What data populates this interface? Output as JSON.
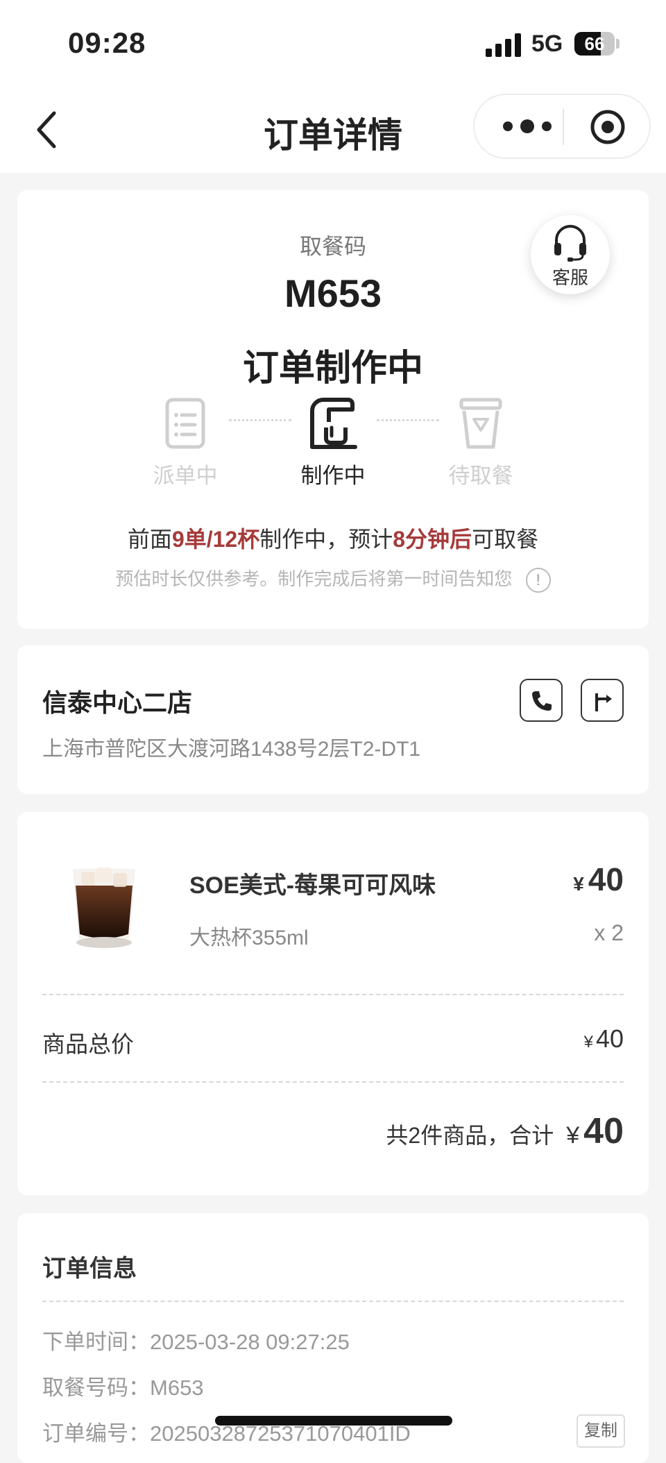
{
  "status_bar": {
    "time": "09:28",
    "network": "5G",
    "battery": "66",
    "battery_level_percent": 66
  },
  "nav": {
    "title": "订单详情"
  },
  "order": {
    "pickup_label": "取餐码",
    "pickup_code": "M653",
    "status": "订单制作中",
    "service_label": "客服",
    "steps": [
      {
        "label": "派单中",
        "state": "done"
      },
      {
        "label": "制作中",
        "state": "active"
      },
      {
        "label": "待取餐",
        "state": "pending"
      }
    ],
    "queue": {
      "prefix": "前面",
      "count": "9单/12杯",
      "mid": "制作中，预计",
      "eta": "8分钟后",
      "suffix": "可取餐"
    },
    "note": "预估时长仅供参考。制作完成后将第一时间告知您",
    "note_icon": "!"
  },
  "store": {
    "name": "信泰中心二店",
    "address": "上海市普陀区大渡河路1438号2层T2-DT1"
  },
  "product": {
    "name": "SOE美式-莓果可可风味",
    "spec": "大热杯355ml",
    "currency": "¥",
    "price": "40",
    "qty": "x 2"
  },
  "summary": {
    "subtotal_label": "商品总价",
    "subtotal_currency": "¥",
    "subtotal_value": "40",
    "total_text": "共2件商品，合计",
    "total_currency": "¥",
    "total_value": "40"
  },
  "info": {
    "title": "订单信息",
    "order_time_label": "下单时间：",
    "order_time": "2025-03-28 09:27:25",
    "pickup_no_label": "取餐号码：",
    "pickup_no": "M653",
    "order_no_label": "订单编号：",
    "order_no": "20250328725371070401ID",
    "copy_label": "复制"
  },
  "colors": {
    "highlight": "#a63a3a",
    "muted": "#cfcfcf"
  }
}
